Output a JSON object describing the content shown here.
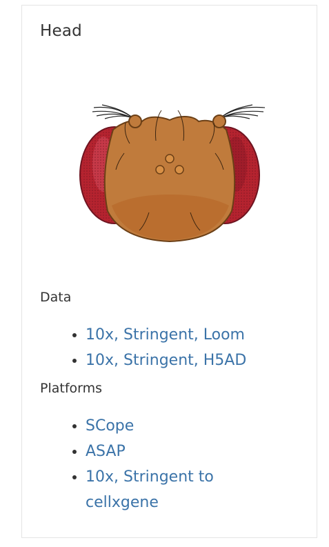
{
  "card": {
    "title": "Head",
    "illustration_icon": "fly-head-illustration",
    "data_section": {
      "label": "Data",
      "links": [
        {
          "label": "10x, Stringent, Loom"
        },
        {
          "label": "10x, Stringent, H5AD"
        }
      ]
    },
    "platforms_section": {
      "label": "Platforms",
      "links": [
        {
          "label": "SCope"
        },
        {
          "label": "ASAP"
        },
        {
          "label": "10x, Stringent to cellxgene"
        }
      ]
    }
  },
  "colors": {
    "link": "#3b73a8",
    "text": "#333333",
    "border": "#e4e4e4",
    "head_body": "#c07b3c",
    "eye": "#b5232f"
  }
}
